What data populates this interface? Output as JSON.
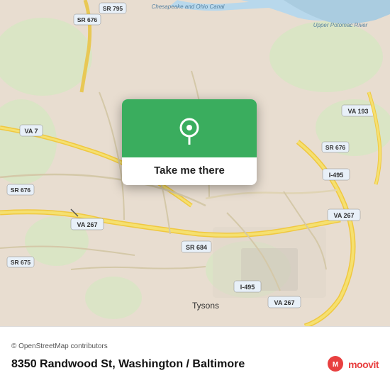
{
  "map": {
    "alt": "Map of Washington / Baltimore area showing roads",
    "bg_color": "#e8ddd0",
    "water_color": "#b8d4e8",
    "road_major_color": "#f0d070",
    "road_minor_color": "#f5f0e8",
    "road_highway_color": "#f0d060"
  },
  "popup": {
    "header_color": "#3aad5e",
    "label": "Take me there",
    "pin_color": "white"
  },
  "labels": {
    "sr_795": "SR 795",
    "sr_676_top": "SR 676",
    "va7": "VA 7",
    "sr_676_mid": "SR 676",
    "sr_675_bot": "SR 675",
    "sr_676_right": "SR 676",
    "va_193": "VA 193",
    "i_495_right": "I-495",
    "va_267_left": "VA 267",
    "sr_684": "SR 684",
    "va_267_right": "VA 267",
    "i_495_bot": "I-495",
    "va_267_bot": "VA 267",
    "chesapeake": "Chesapeake and Ohio Canal",
    "upper_potomac": "Upper Potomac River",
    "tysons": "Tysons"
  },
  "footer": {
    "attribution": "© OpenStreetMap contributors",
    "address": "8350 Randwood St, Washington / Baltimore",
    "moovit_label": "moovit"
  }
}
